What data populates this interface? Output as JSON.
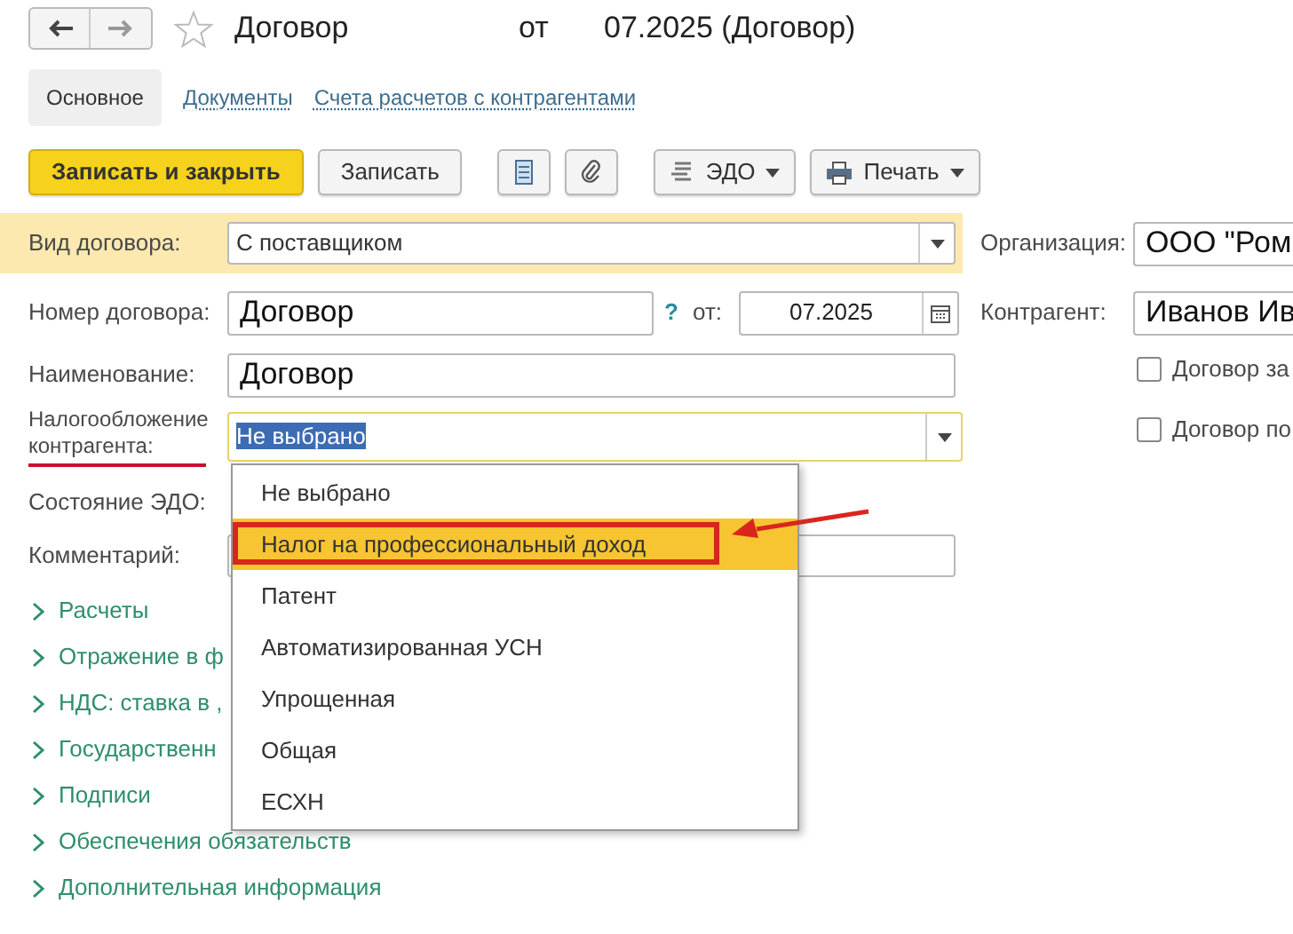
{
  "window": {
    "title": "Договор",
    "from": "от",
    "date": "07.2025 (Договор)",
    "favorite": false
  },
  "tabs": [
    {
      "label": "Основное",
      "selected": true
    },
    {
      "label": "Документы",
      "selected": false
    },
    {
      "label": "Счета расчетов с контрагентами",
      "selected": false
    }
  ],
  "toolbar": [
    {
      "kind": "primary",
      "label": "Записать и закрыть"
    },
    {
      "kind": "plain",
      "label": "Записать"
    },
    {
      "kind": "list"
    },
    {
      "kind": "attach"
    },
    {
      "kind": "edo",
      "label": "ЭДО"
    },
    {
      "kind": "print",
      "label": "Печать"
    }
  ],
  "form": {
    "contract_type": {
      "label": "Вид договора:",
      "value": "С поставщиком"
    },
    "number": {
      "label": "Номер договора:",
      "value": "Договор",
      "help": "?",
      "date_label": "от:",
      "date": "07.2025"
    },
    "name": {
      "label": "Наименование:",
      "value": "Договор"
    },
    "taxation": {
      "label": "Налогообложение контрагента:",
      "value": "Не выбрано",
      "expanded": true,
      "underlined": true
    },
    "edo_state": {
      "label": "Состояние ЭДО:"
    },
    "comment": {
      "label": "Комментарий:"
    }
  },
  "groups": [
    {
      "label": "Расчеты",
      "expanded": false
    },
    {
      "label": "Отражение в ф",
      "expanded": false
    },
    {
      "label": "НДС: ставка в ,",
      "expanded": false
    },
    {
      "label": "Государственн",
      "expanded": false
    },
    {
      "label": "Подписи",
      "expanded": false
    },
    {
      "label": "Обеспечения обязательств",
      "expanded": false
    },
    {
      "label": "Дополнительная информация",
      "expanded": false
    }
  ],
  "right": {
    "organization": {
      "label": "Организация:",
      "value": "ООО \"Ром"
    },
    "counterparty": {
      "label": "Контрагент:",
      "value": "Иванов Ив"
    },
    "checkboxes": [
      {
        "label": "Договор за",
        "checked": false
      },
      {
        "label": "Договор по",
        "checked": false
      }
    ]
  },
  "dropdown": {
    "options": [
      {
        "label": "Не выбрано",
        "selected": false
      },
      {
        "label": "Налог на профессиональный доход",
        "selected": true
      },
      {
        "label": "Патент",
        "selected": false
      },
      {
        "label": "Автоматизированная УСН",
        "selected": false
      },
      {
        "label": "Упрощенная",
        "selected": false
      },
      {
        "label": "Общая",
        "selected": false
      },
      {
        "label": "ЕСХН",
        "selected": false
      }
    ]
  }
}
